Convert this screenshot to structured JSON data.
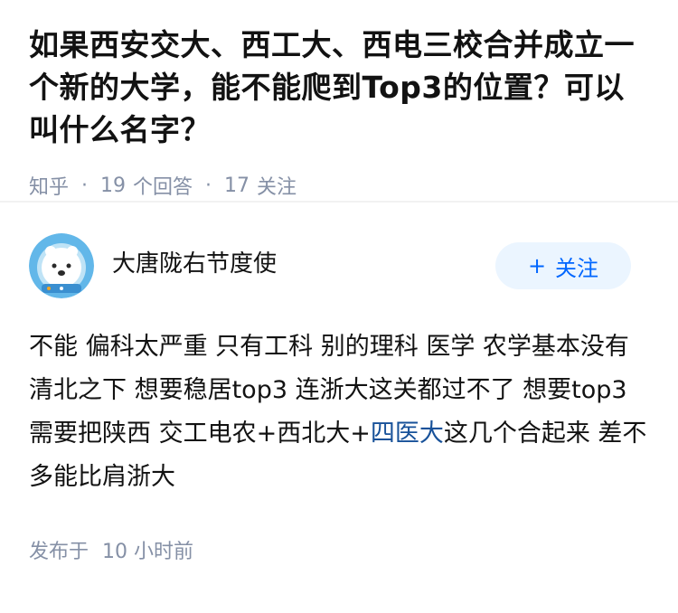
{
  "question": {
    "title": "如果西安交大、西工大、西电三校合并成立一个新的大学，能不能爬到Top3的位置？可以叫什么名字？",
    "source": "知乎",
    "answer_count": "19",
    "answer_label": "个回答",
    "follow_count": "17",
    "follow_label": "关注",
    "separator": "·"
  },
  "answer": {
    "author_name": "大唐陇右节度使",
    "follow_button_plus": "+",
    "follow_button_label": "关注",
    "content_part1": "不能 偏科太严重 只有工科 别的理科 医学 农学基本没有 清北之下 想要稳居top3 连浙大这关都过不了 想要top3 需要把陕西 交工电农+西北大+",
    "content_link": "四医大",
    "content_part2": "这几个合起来 差不多能比肩浙大",
    "post_time_label": "发布于",
    "post_time_value": "10 小时前"
  },
  "colors": {
    "meta_gray": "#8590a6",
    "link_blue": "#175199",
    "follow_bg": "#ebf5ff",
    "follow_text": "#0066ff"
  },
  "icons": {
    "avatar": "polar-bear-astronaut-avatar"
  }
}
